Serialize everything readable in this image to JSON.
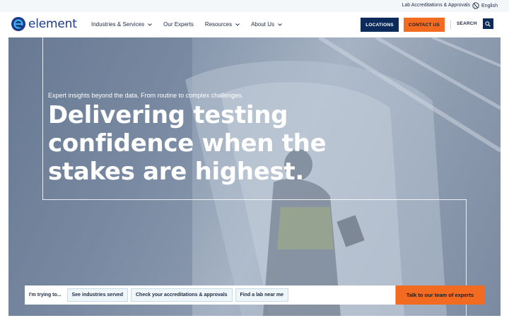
{
  "utility": {
    "accreditations_link": "Lab Accreditations & Approvals",
    "language": "English",
    "globe_icon": "globe-icon"
  },
  "header": {
    "logo_text": "element",
    "logo_icon": "element-logo-icon",
    "nav": [
      {
        "label": "Industries & Services",
        "has_dropdown": true
      },
      {
        "label": "Our Experts",
        "has_dropdown": false
      },
      {
        "label": "Resources",
        "has_dropdown": true
      },
      {
        "label": "About Us",
        "has_dropdown": true
      }
    ],
    "locations_label": "LOCATIONS",
    "contact_label": "CONTACT US",
    "search_label": "SEARCH",
    "search_icon": "search-icon"
  },
  "hero": {
    "subtitle": "Expert insights beyond the data. From routine to complex challenges.",
    "title": "Delivering testing confidence when the stakes are highest."
  },
  "action_bar": {
    "prompt": "I'm trying to...",
    "chips": [
      "See industries served",
      "Check your accreditations & approvals",
      "Find a lab near me"
    ],
    "cta": "Talk to our team of experts"
  },
  "colors": {
    "brand_navy": "#0c2b5b",
    "brand_orange": "#f26b21",
    "logo_blue": "#1b3a8c"
  }
}
